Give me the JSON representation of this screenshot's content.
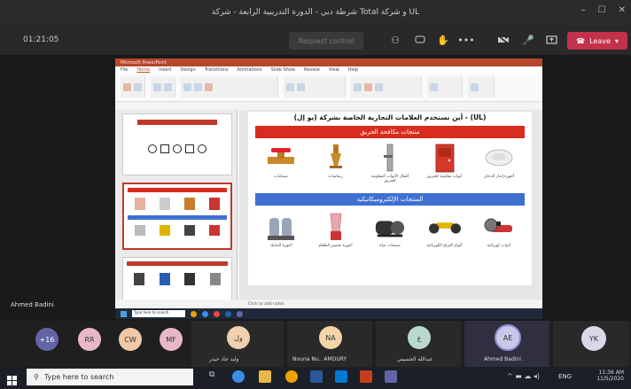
{
  "window": {
    "title": "شرطة دبي - الدورة التدريبية الرابعة - شركة Total و شركة UL",
    "controls": [
      "–",
      "☐",
      "✕"
    ]
  },
  "meeting": {
    "timer": "01:21:05",
    "request_control": "Request control",
    "leave_label": "Leave"
  },
  "powerpoint": {
    "title_text": "Microsoft PowerPoint",
    "tabs": [
      "File",
      "Home",
      "Insert",
      "Design",
      "Transitions",
      "Animations",
      "Slide Show",
      "Review",
      "View",
      "Help"
    ],
    "status_text": "Click to add notes"
  },
  "slide": {
    "heading": "أين تستخدم العلامات التجارية الخاصة بشركة (يو إل) - (UL)",
    "section1": "منتجات مكافحة الحريق",
    "section2": "المنتجات الإلكتروميكانيكية",
    "row1": [
      {
        "label": "صمامات",
        "icon": "valve-icon"
      },
      {
        "label": "رشاشات",
        "icon": "sprinkler-icon"
      },
      {
        "label": "أقفال الأبواب المقاومة للحريق",
        "icon": "door-lock-icon"
      },
      {
        "label": "أبواب مقاومة للحريق",
        "icon": "fire-door-icon"
      },
      {
        "label": "أجهزة إنذار الدخان",
        "icon": "smoke-detector-icon"
      }
    ],
    "row2": [
      {
        "label": "أجهزة التدليك",
        "icon": "massager-icon"
      },
      {
        "label": "أجهزة تحضير الطعام",
        "icon": "blender-icon"
      },
      {
        "label": "مضخات مياه",
        "icon": "pump-icon"
      },
      {
        "label": "ألواح التزلج الكهربائية",
        "icon": "hoverboard-icon"
      },
      {
        "label": "أدوات كهربائية",
        "icon": "grinder-icon"
      }
    ]
  },
  "presenter": "Ahmed Badini",
  "participants": [
    {
      "initials": "+16",
      "name": "",
      "color": "#6264a7"
    },
    {
      "initials": "RR",
      "name": "",
      "color": "#e8b8c8"
    },
    {
      "initials": "CW",
      "name": "",
      "color": "#f0c8a8"
    },
    {
      "initials": "MF",
      "name": "",
      "color": "#e8b8c8"
    },
    {
      "initials": "ول",
      "name": "ولید جاد حيدر",
      "color": "#f0d0b0"
    },
    {
      "initials": "NA",
      "name": "Nouna Nu.. AMOURY",
      "color": "#f2d4a8"
    },
    {
      "initials": "ع",
      "name": "عبدالله الحسيني",
      "color": "#b8d8d0"
    },
    {
      "initials": "AE",
      "name": "Ahmed Badini",
      "color": "#c8c8e8"
    },
    {
      "initials": "YK",
      "name": "",
      "color": "#d8d8e8"
    }
  ],
  "taskbar": {
    "search_placeholder": "Type here to search",
    "time": "11:36 AM",
    "date": "11/5/2020",
    "lang": "ENG"
  }
}
